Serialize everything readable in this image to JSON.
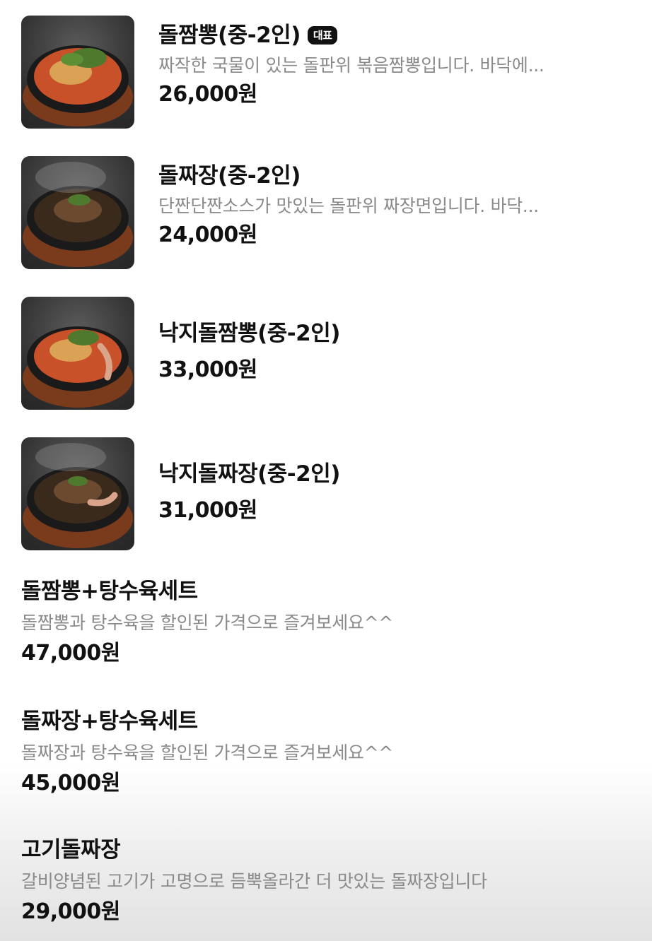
{
  "items_with_image": [
    {
      "name": "돌짬뽕(중-2인)",
      "badge": "대표",
      "desc": "짜작한 국물이 있는 돌판위 볶음짬뽕입니다. 바닥에...",
      "price": "26,000원",
      "image": "spicy-seafood-noodle-plate"
    },
    {
      "name": "돌짜장(중-2인)",
      "desc": "단짠단짠소스가 맛있는 돌판위 짜장면입니다. 바닥...",
      "price": "24,000원",
      "image": "black-bean-noodle-plate"
    },
    {
      "name": "낙지돌짬뽕(중-2인)",
      "price": "33,000원",
      "image": "octopus-spicy-noodle-plate"
    },
    {
      "name": "낙지돌짜장(중-2인)",
      "price": "31,000원",
      "image": "octopus-black-bean-noodle-plate"
    }
  ],
  "items_plain": [
    {
      "name": "돌짬뽕+탕수육세트",
      "desc": "돌짬뽕과 탕수육을 할인된 가격으로 즐겨보세요^^",
      "price": "47,000원"
    },
    {
      "name": "돌짜장+탕수육세트",
      "desc": "돌짜장과 탕수육을 할인된 가격으로 즐겨보세요^^",
      "price": "45,000원"
    },
    {
      "name": "고기돌짜장",
      "desc": "갈비양념된 고기가 고명으로 듬뿍올라간 더 맛있는 돌짜장입니다",
      "price": "29,000원"
    }
  ],
  "colors": {
    "spicy": "#c9512a",
    "blackbean": "#3a2a1c",
    "greens": "#4f7a2e",
    "board": "#7a3b1c"
  }
}
